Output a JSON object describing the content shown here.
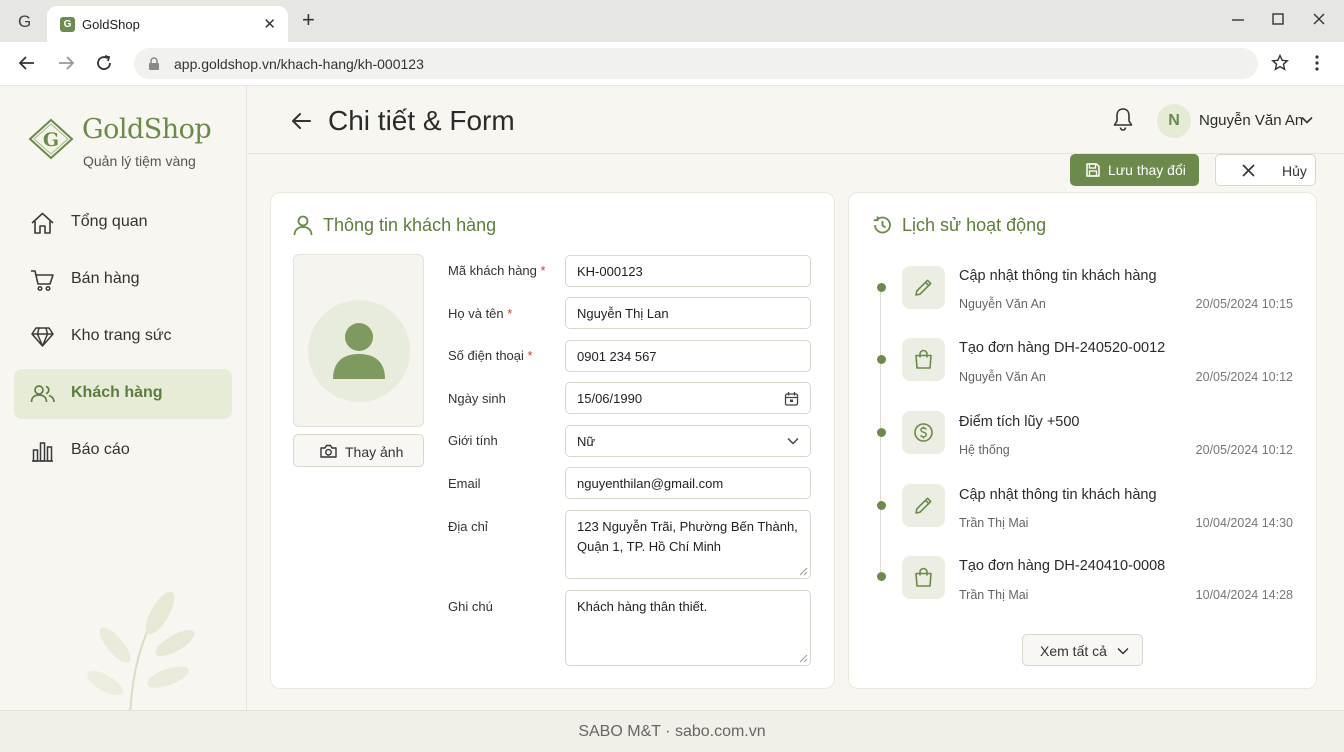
{
  "browser": {
    "profile_letter": "G",
    "tab_title": "GoldShop",
    "tab_favicon": "G",
    "url": "app.goldshop.vn/khach-hang/kh-000123"
  },
  "brand": {
    "name": "GoldShop",
    "subtitle": "Quản lý tiệm vàng",
    "logo_letter": "G",
    "accent": "#6b8a48"
  },
  "sidebar": {
    "items": [
      {
        "label": "Tổng quan",
        "icon": "home-icon",
        "active": false
      },
      {
        "label": "Bán hàng",
        "icon": "cart-icon",
        "active": false
      },
      {
        "label": "Kho trang sức",
        "icon": "diamond-icon",
        "active": false
      },
      {
        "label": "Khách hàng",
        "icon": "users-icon",
        "active": true
      },
      {
        "label": "Báo cáo",
        "icon": "bar-chart-icon",
        "active": false
      }
    ]
  },
  "header": {
    "title": "Chi tiết & Form",
    "user_initial": "N",
    "user_name": "Nguyễn Văn An"
  },
  "actions": {
    "save_label": "Lưu thay đổi",
    "cancel_label": "Hủy"
  },
  "customer": {
    "card_title": "Thông tin khách hàng",
    "change_photo_label": "Thay ảnh",
    "required_mark": "*",
    "fields": {
      "code": {
        "label": "Mã khách hàng",
        "value": "KH-000123",
        "required": true
      },
      "name": {
        "label": "Họ và tên",
        "value": "Nguyễn Thị Lan",
        "required": true
      },
      "phone": {
        "label": "Số điện thoại",
        "value": "0901 234 567",
        "required": true
      },
      "dob": {
        "label": "Ngày sinh",
        "value": "15/06/1990"
      },
      "gender": {
        "label": "Giới tính",
        "value": "Nữ"
      },
      "email": {
        "label": "Email",
        "value": "nguyenthilan@gmail.com"
      },
      "address": {
        "label": "Địa chỉ",
        "value": "123 Nguyễn Trãi, Phường Bến Thành, Quận 1, TP. Hồ Chí Minh"
      },
      "note": {
        "label": "Ghi chú",
        "value": "Khách hàng thân thiết."
      }
    }
  },
  "activity": {
    "card_title": "Lịch sử hoạt động",
    "items": [
      {
        "icon": "pencil-icon",
        "title": "Cập nhật thông tin khách hàng",
        "user": "Nguyễn Văn An",
        "time": "20/05/2024 10:15"
      },
      {
        "icon": "shopping-bag-icon",
        "title": "Tạo đơn hàng DH-240520-0012",
        "user": "Nguyễn Văn An",
        "time": "20/05/2024 10:12"
      },
      {
        "icon": "dollar-coin-icon",
        "title": "Điểm tích lũy +500",
        "user": "Hệ thống",
        "time": "20/05/2024 10:12"
      },
      {
        "icon": "pencil-icon",
        "title": "Cập nhật thông tin khách hàng",
        "user": "Trần Thị Mai",
        "time": "10/04/2024 14:30"
      },
      {
        "icon": "shopping-bag-icon",
        "title": "Tạo đơn hàng DH-240410-0008",
        "user": "Trần Thị Mai",
        "time": "10/04/2024 14:28"
      }
    ],
    "view_all_label": "Xem tất cả"
  },
  "footer": {
    "text": "SABO M&T · sabo.com.vn"
  }
}
